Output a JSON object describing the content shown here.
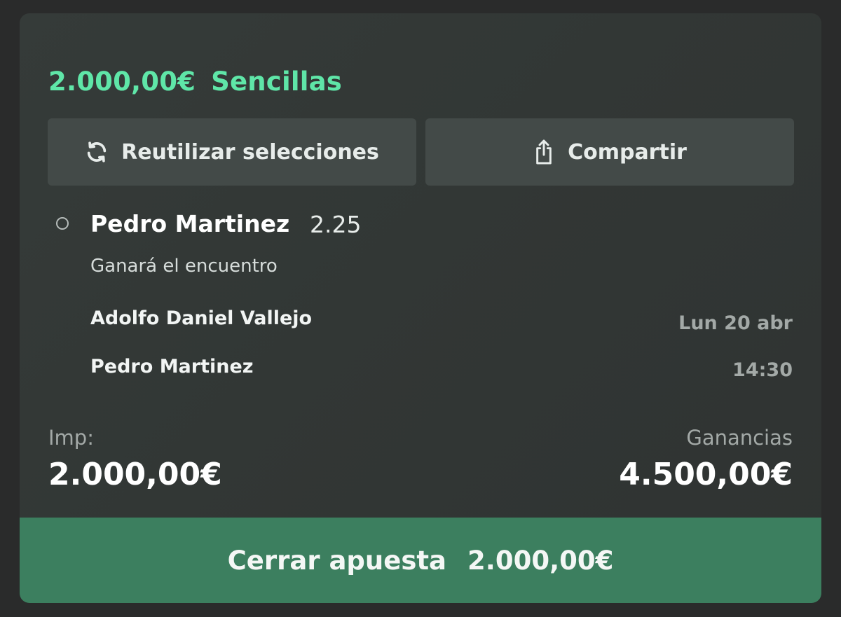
{
  "bet": {
    "total": "2.000,00€",
    "type": "Sencillas"
  },
  "actions": {
    "reuse_label": "Reutilizar selecciones",
    "reuse_icon": "refresh-icon",
    "share_label": "Compartir",
    "share_icon": "share-icon"
  },
  "selection": {
    "name": "Pedro Martinez",
    "odds": "2.25",
    "market": "Ganará el encuentro",
    "team1": "Adolfo Daniel Vallejo",
    "team2": "Pedro Martinez",
    "date": "Lun 20 abr",
    "time": "14:30"
  },
  "summary": {
    "stake_label": "Imp:",
    "stake": "2.000,00€",
    "winnings_label": "Ganancias",
    "winnings": "4.500,00€"
  },
  "cashout": {
    "label": "Cerrar apuesta",
    "amount": "2.000,00€"
  },
  "colors": {
    "accent": "#5fe6a8",
    "cta_background": "#3c7f5f",
    "button_background": "#434a48"
  }
}
